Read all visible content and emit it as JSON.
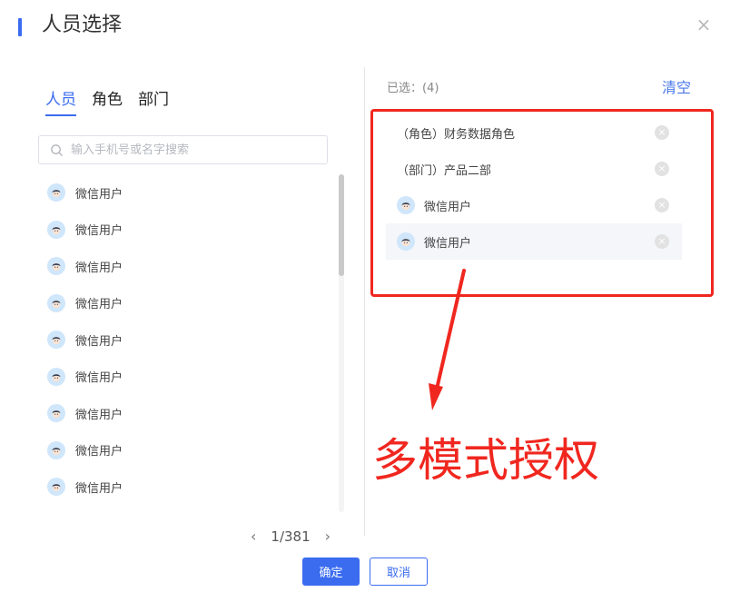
{
  "dialog": {
    "title": "人员选择",
    "close_icon": "×"
  },
  "tabs": [
    {
      "label": "人员",
      "active": true
    },
    {
      "label": "角色",
      "active": false
    },
    {
      "label": "部门",
      "active": false
    }
  ],
  "search": {
    "placeholder": "输入手机号或名字搜索",
    "value": ""
  },
  "users": [
    {
      "name": "微信用户"
    },
    {
      "name": "微信用户"
    },
    {
      "name": "微信用户"
    },
    {
      "name": "微信用户"
    },
    {
      "name": "微信用户"
    },
    {
      "name": "微信用户"
    },
    {
      "name": "微信用户"
    },
    {
      "name": "微信用户"
    },
    {
      "name": "微信用户"
    }
  ],
  "pagination": {
    "prev_icon": "‹",
    "next_icon": "›",
    "text": "1/381"
  },
  "selected": {
    "count_label": "已选：(4)",
    "clear_label": "清空",
    "items": [
      {
        "label": "（角色）财务数据角色",
        "has_avatar": false
      },
      {
        "label": "（部门）产品二部",
        "has_avatar": false
      },
      {
        "label": "微信用户",
        "has_avatar": true
      },
      {
        "label": "微信用户",
        "has_avatar": true
      }
    ]
  },
  "annotation": {
    "text": "多模式授权",
    "color": "#f0271f"
  },
  "buttons": {
    "ok_label": "确定",
    "cancel_label": "取消"
  },
  "colors": {
    "accent": "#3b6cf0",
    "annotation_red": "#f0271f"
  }
}
